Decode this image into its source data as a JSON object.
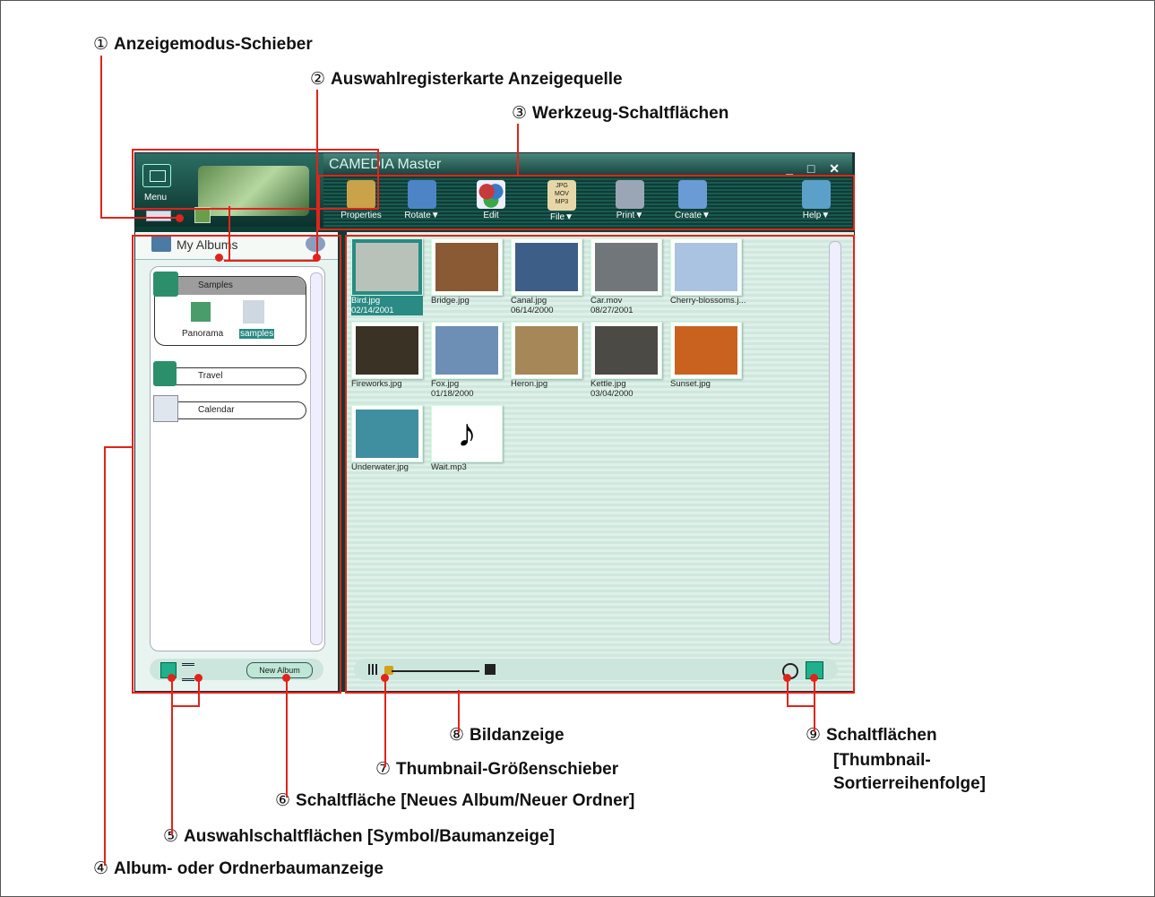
{
  "callouts": [
    {
      "num": "①",
      "text": "Anzeigemodus-Schieber"
    },
    {
      "num": "②",
      "text": "Auswahlregisterkarte Anzeigequelle"
    },
    {
      "num": "③",
      "text": "Werkzeug-Schaltflächen"
    },
    {
      "num": "④",
      "text": "Album- oder Ordnerbaumanzeige"
    },
    {
      "num": "⑤",
      "text": "Auswahlschaltflächen [Symbol/Baumanzeige]"
    },
    {
      "num": "⑥",
      "text": "Schaltfläche [Neues Album/Neuer Ordner]"
    },
    {
      "num": "⑦",
      "text": "Thumbnail-Größenschieber"
    },
    {
      "num": "⑧",
      "text": "Bildanzeige"
    },
    {
      "num": "⑨",
      "text": "Schaltflächen",
      "line2": "[Thumbnail-",
      "line3": "Sortierreihenfolge]"
    }
  ],
  "window": {
    "title": "CAMEDIA Master",
    "controls": "_ □ ✕"
  },
  "menu": {
    "label": "Menu"
  },
  "toolbar": {
    "buttons": [
      {
        "label": "Properties",
        "icon": "properties-icon",
        "color": "#c9a24a"
      },
      {
        "label": "Rotate▼",
        "icon": "rotate-icon",
        "color": "#4c84c6"
      },
      {
        "label": "Edit",
        "icon": "edit-icon",
        "color": "#c83a3a"
      },
      {
        "label": "File▼",
        "icon": "file-icon",
        "color": "#e7d7a8"
      },
      {
        "label": "Print▼",
        "icon": "print-icon",
        "color": "#9aa6b6"
      },
      {
        "label": "Create▼",
        "icon": "create-icon",
        "color": "#6a9bd4"
      },
      {
        "label": "Help▼",
        "icon": "help-icon",
        "color": "#5aa0c8"
      }
    ],
    "file_icon_text": [
      "JPG",
      "MOV",
      "MP3"
    ]
  },
  "tab": {
    "label": "My Albums"
  },
  "albums": {
    "samples": {
      "label": "Samples",
      "children": [
        "Panorama",
        "samples"
      ]
    },
    "travel": {
      "label": "Travel"
    },
    "calendar": {
      "label": "Calendar"
    }
  },
  "new_album": {
    "label": "New Album"
  },
  "thumbnails": [
    {
      "name": "Bird.jpg",
      "date": "02/14/2001",
      "selected": true,
      "color": "#b9c2b8"
    },
    {
      "name": "Bridge.jpg",
      "date": "",
      "color": "#8a5a34"
    },
    {
      "name": "Canal.jpg",
      "date": "06/14/2000",
      "color": "#3d5e86"
    },
    {
      "name": "Car.mov",
      "date": "08/27/2001",
      "color": "#70767a"
    },
    {
      "name": "Cherry-blossoms.j...",
      "date": "",
      "color": "#a9c3e0"
    },
    {
      "name": "Fireworks.jpg",
      "date": "",
      "color": "#3a3224"
    },
    {
      "name": "Fox.jpg",
      "date": "01/18/2000",
      "color": "#6d8fb5"
    },
    {
      "name": "Heron.jpg",
      "date": "",
      "color": "#a58758"
    },
    {
      "name": "Kettle.jpg",
      "date": "03/04/2000",
      "color": "#4b4a44"
    },
    {
      "name": "Sunset.jpg",
      "date": "",
      "color": "#c9621f"
    },
    {
      "name": "Underwater.jpg",
      "date": "",
      "color": "#3f8fa0"
    },
    {
      "name": "Wait.mp3",
      "date": "",
      "color": "#ffffff"
    }
  ],
  "colors": {
    "accent": "#e2231a",
    "app_dark": "#0c3d35",
    "panel": "#dff0e8"
  }
}
